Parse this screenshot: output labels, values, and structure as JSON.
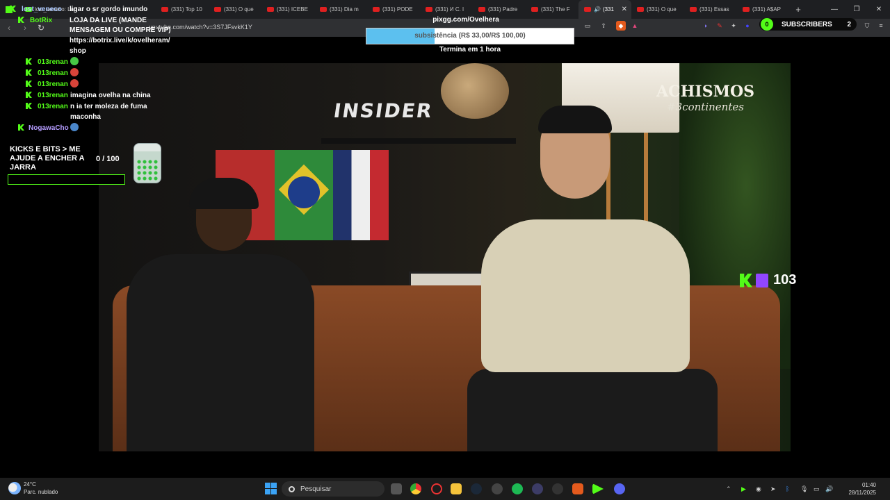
{
  "browser": {
    "tabs": [
      {
        "label": "Kick"
      },
      {
        "label": "lost_veneco: Lad"
      },
      {
        "label": "(331) Top 10"
      },
      {
        "label": "(331) O que"
      },
      {
        "label": "(331) ICEBE"
      },
      {
        "label": "(331) Dia m"
      },
      {
        "label": "(331) PODE"
      },
      {
        "label": "(331) И С. l"
      },
      {
        "label": "(331) Padre"
      },
      {
        "label": "(331) The F"
      },
      {
        "label": "(331"
      },
      {
        "label": "(331) O que"
      },
      {
        "label": "(331) Essas"
      },
      {
        "label": "(331) A$AP"
      }
    ],
    "url": "youtube.com/watch?v=3S7JFsvkK1Y",
    "new_tab": "+",
    "controls": {
      "minimize": "—",
      "maximize": "❐",
      "close": "✕"
    }
  },
  "chat": {
    "messages": [
      {
        "user": "lost_veneco",
        "text": "ligar o sr gordo imundo"
      },
      {
        "user": "BotRix",
        "text": "LOJA DA LIVE (MANDE"
      },
      {
        "user": "",
        "text": "MENSAGEM OU COMPRE VIP)"
      },
      {
        "user": "",
        "text": "https://botrix.live/k/ovelheram/"
      },
      {
        "user": "",
        "text": "shop"
      },
      {
        "user": "013renan",
        "text": ""
      },
      {
        "user": "013renan",
        "text": ""
      },
      {
        "user": "013renan",
        "text": ""
      },
      {
        "user": "013renan",
        "text": "imagina ovelha na china"
      },
      {
        "user": "013renan",
        "text": "n ia ter moleza de fuma"
      },
      {
        "user": "",
        "text": "maconha"
      },
      {
        "user": "NogawaCho",
        "text": ""
      }
    ]
  },
  "donation_goal": {
    "link": "pixgg.com/Ovelhera",
    "label": "subsistência (R$ 33,00/R$ 100,00)",
    "progress": 0.33,
    "ends": "Termina em 1 hora"
  },
  "subscribers": {
    "left_count": "0",
    "label": "SUBSCRIBERS",
    "right_count": "2"
  },
  "jar": {
    "title": "KICKS E BITS > ME AJUDE A ENCHER A JARRA",
    "count": "0   / 100",
    "progress": 0.0
  },
  "video": {
    "brand": "INSIDER",
    "show_title": "ACHISMOS",
    "show_tag": "#3continentes"
  },
  "viewers": {
    "count": "103"
  },
  "taskbar": {
    "weather_temp": "24°C",
    "weather_desc": "Parc. nublado",
    "search_placeholder": "Pesquisar",
    "time": "01:40",
    "date": "28/11/2025"
  },
  "colors": {
    "kick_green": "#53fc18",
    "twitch_purple": "#9146ff",
    "goal_fill": "#5cc0ef"
  }
}
